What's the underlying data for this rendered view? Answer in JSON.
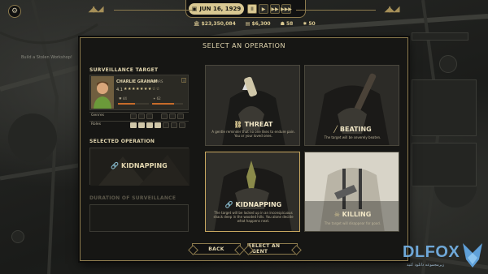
{
  "topbar": {
    "date": "JUN 16, 1929",
    "speed_buttons": [
      "II",
      "▶",
      "▶▶",
      "▶▶▶"
    ],
    "money": "$23,350,084",
    "cash": "$6,300",
    "stat1": "58",
    "stat2": "50"
  },
  "background": {
    "map_label": "Build a Stolen Workshop!"
  },
  "dialog": {
    "title": "SELECT AN OPERATION",
    "surveillance_target_label": "SURVEILLANCE TARGET",
    "target": {
      "name": "CHARLIE GRAHAM",
      "age": "43 YEARS",
      "rating": "4.1",
      "stars": "★★★★★★★☆☆",
      "stat_left": "44",
      "stat_right": "62",
      "stat_left_level": 0.55,
      "stat_right_level": 0.7,
      "info": "i"
    },
    "traits": [
      {
        "label": "Genres"
      },
      {
        "label": "Roles"
      }
    ],
    "selected_operation_label": "SELECTED OPERATION",
    "selected_operation": "KIDNAPPING",
    "duration_label": "DURATION OF SURVEILLANCE",
    "operations": [
      {
        "name": "THREAT",
        "desc": "A gentle reminder that no one likes to endure pain. You or your loved ones."
      },
      {
        "name": "BEATING",
        "desc": "The target will be severely beaten."
      },
      {
        "name": "KIDNAPPING",
        "desc": "The target will be locked up in an inconspicuous shack deep in the wooded hills. You alone decide what happens next."
      },
      {
        "name": "KILLING",
        "desc": "The target will disappear for good."
      }
    ],
    "back_button": "BACK",
    "select_agent_button": "SELECT AN AGENT"
  },
  "watermark": {
    "brand": "DLFOX",
    "tagline": "زیرمجموعه دانلود کنید"
  },
  "colors": {
    "gold": "#8d7b4e",
    "accent": "#d9c892",
    "selected_border": "#c8a860"
  }
}
